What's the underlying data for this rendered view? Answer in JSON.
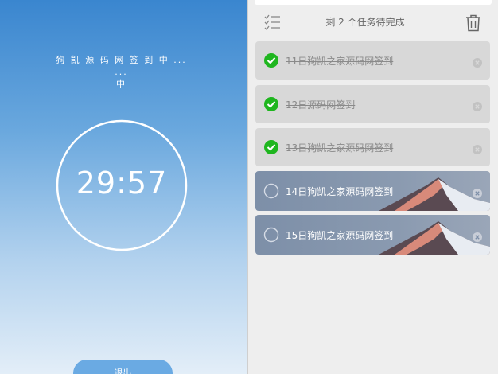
{
  "timer_panel": {
    "task_title_line1": "狗 凯 源 码 网 签 到 中 ... ...",
    "task_title_line2": "中",
    "time": "29:57",
    "exit_label": "退出"
  },
  "task_panel": {
    "remaining_text": "剩 2 个任务待完成",
    "tasks": [
      {
        "label": "11日狗凯之家源码网签到",
        "done": true
      },
      {
        "label": "12日源码网签到",
        "done": true
      },
      {
        "label": "13日狗凯之家源码网签到",
        "done": true
      },
      {
        "label": "14日狗凯之家源码网签到",
        "done": false
      },
      {
        "label": "15日狗凯之家源码网签到",
        "done": false
      }
    ]
  },
  "colors": {
    "check_green": "#1fb61f",
    "accent_blue": "#3a86cf"
  },
  "icons": {
    "header_list": "checklist-icon",
    "header_trash": "trash-icon",
    "task_done": "check-circle-icon",
    "task_pending": "empty-circle-icon",
    "task_delete": "close-circle-icon"
  }
}
